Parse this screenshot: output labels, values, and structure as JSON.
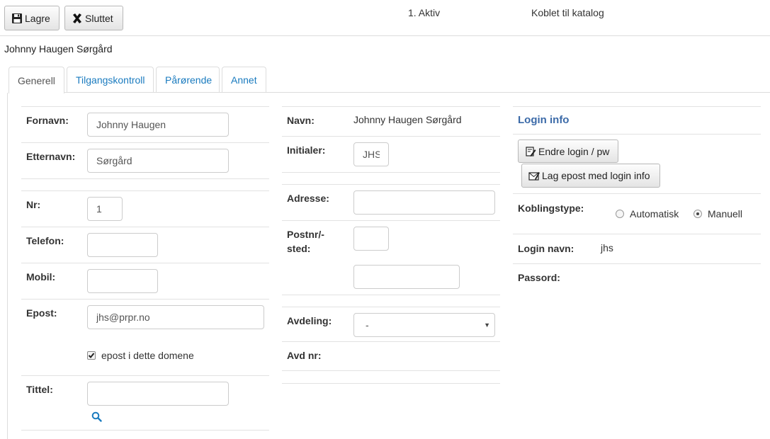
{
  "toolbar": {
    "save_label": "Lagre",
    "close_label": "Sluttet",
    "status_active": "1. Aktiv",
    "status_catalog": "Koblet til katalog"
  },
  "user": {
    "full_name": "Johnny Haugen Sørgård"
  },
  "tabs": [
    {
      "label": "Generell",
      "active": true
    },
    {
      "label": "Tilgangskontroll",
      "active": false
    },
    {
      "label": "Pårørende",
      "active": false
    },
    {
      "label": "Annet",
      "active": false
    }
  ],
  "left": {
    "fornavn_label": "Fornavn:",
    "fornavn_value": "Johnny Haugen",
    "etternavn_label": "Etternavn:",
    "etternavn_value": "Sørgård",
    "nr_label": "Nr:",
    "nr_value": "1",
    "telefon_label": "Telefon:",
    "telefon_value": "",
    "mobil_label": "Mobil:",
    "mobil_value": "",
    "epost_label": "Epost:",
    "epost_value": "jhs@prpr.no",
    "epost_domain_label": "epost i dette domene",
    "epost_domain_checked": true,
    "tittel_label": "Tittel:",
    "tittel_value": ""
  },
  "middle": {
    "navn_label": "Navn:",
    "navn_value": "Johnny Haugen Sørgård",
    "initialer_label": "Initialer:",
    "initialer_value": "JHS",
    "adresse_label": "Adresse:",
    "adresse_value": "",
    "postnr_label_1": "Postnr/-",
    "postnr_label_2": "sted:",
    "postnr_value": "",
    "sted_value": "",
    "avdeling_label": "Avdeling:",
    "avdeling_value": "-",
    "avdnr_label": "Avd nr:"
  },
  "right": {
    "login_info_title": "Login info",
    "change_login_label": "Endre login / pw",
    "email_login_label": "Lag epost med login info",
    "koblingstype_label": "Koblingstype:",
    "radio_auto": "Automatisk",
    "radio_manual": "Manuell",
    "selected_koblingstype": "Manuell",
    "login_navn_label": "Login navn:",
    "login_navn_value": "jhs",
    "passord_label": "Passord:"
  },
  "colors": {
    "link": "#1a7bbf",
    "section_title": "#3b6aa8"
  }
}
